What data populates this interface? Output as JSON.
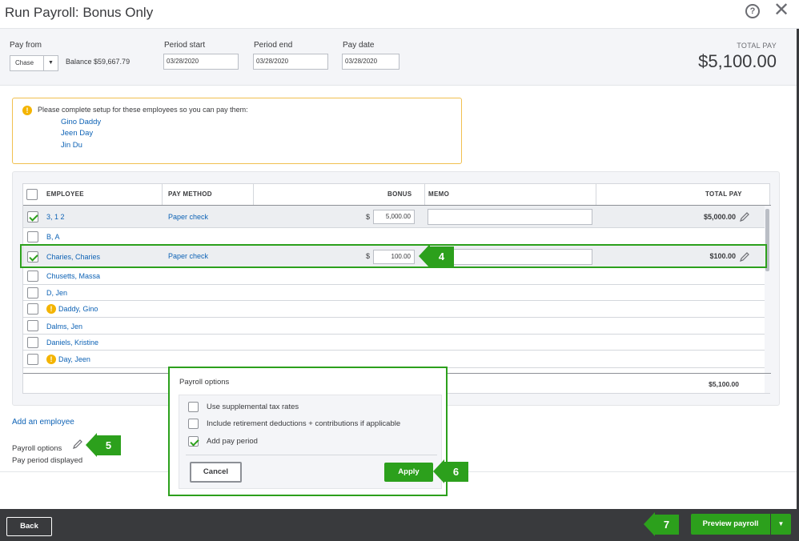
{
  "window": {
    "title": "Run Payroll: Bonus Only",
    "help_icon": "?",
    "close_icon": "✕"
  },
  "header": {
    "pay_from_label": "Pay from",
    "pay_from_value": "Chase",
    "dropdown_arrow": "▼",
    "balance": "Balance $59,667.79",
    "period_start_label": "Period start",
    "period_start_value": "03/28/2020",
    "period_end_label": "Period end",
    "period_end_value": "03/28/2020",
    "pay_date_label": "Pay date",
    "pay_date_value": "03/28/2020",
    "total_pay_label": "TOTAL PAY",
    "total_pay_value": "$5,100.00"
  },
  "alert": {
    "icon": "!",
    "message": "Please complete setup for these employees so you can pay them:",
    "employees": [
      "Gino Daddy",
      "Jeen Day",
      "Jin Du"
    ]
  },
  "table": {
    "columns": {
      "employee": "EMPLOYEE",
      "pay_method": "PAY METHOD",
      "bonus": "BONUS",
      "memo": "MEMO",
      "total_pay": "TOTAL PAY"
    },
    "rows": [
      {
        "name": "3, 1 2",
        "checked": true,
        "pay_method": "Paper check",
        "bonus": "5,000.00",
        "total": "$5,000.00"
      },
      {
        "name": "B, A",
        "checked": false
      },
      {
        "name": "Charies, Charies",
        "checked": true,
        "pay_method": "Paper check",
        "bonus": "100.00",
        "total": "$100.00"
      },
      {
        "name": "Chusetts, Massa",
        "checked": false
      },
      {
        "name": "D, Jen",
        "checked": false
      },
      {
        "name": "Daddy, Gino",
        "checked": false,
        "warning": true
      },
      {
        "name": "Dalms, Jen",
        "checked": false
      },
      {
        "name": "Daniels, Kristine",
        "checked": false
      },
      {
        "name": "Day, Jeen",
        "checked": false,
        "warning": true
      }
    ],
    "dollar_sign": "$",
    "footer_total": "$5,100.00"
  },
  "callouts": {
    "step4": "4",
    "step5": "5",
    "step6": "6",
    "step7": "7"
  },
  "lower": {
    "add_employee": "Add an employee",
    "payroll_options": "Payroll options",
    "pay_period_displayed": "Pay period displayed"
  },
  "popover": {
    "title": "Payroll options",
    "options": [
      {
        "label": "Use supplemental tax rates",
        "checked": false
      },
      {
        "label": "Include retirement deductions + contributions if applicable",
        "checked": false
      },
      {
        "label": "Add pay period",
        "checked": true
      }
    ],
    "cancel": "Cancel",
    "apply": "Apply"
  },
  "footer": {
    "back": "Back",
    "preview": "Preview payroll",
    "preview_arrow": "▼"
  },
  "colors": {
    "accent_green": "#2ca01c",
    "link_blue": "#0d62b5",
    "warning_yellow": "#f4b400",
    "footer_dark": "#393a3d"
  }
}
